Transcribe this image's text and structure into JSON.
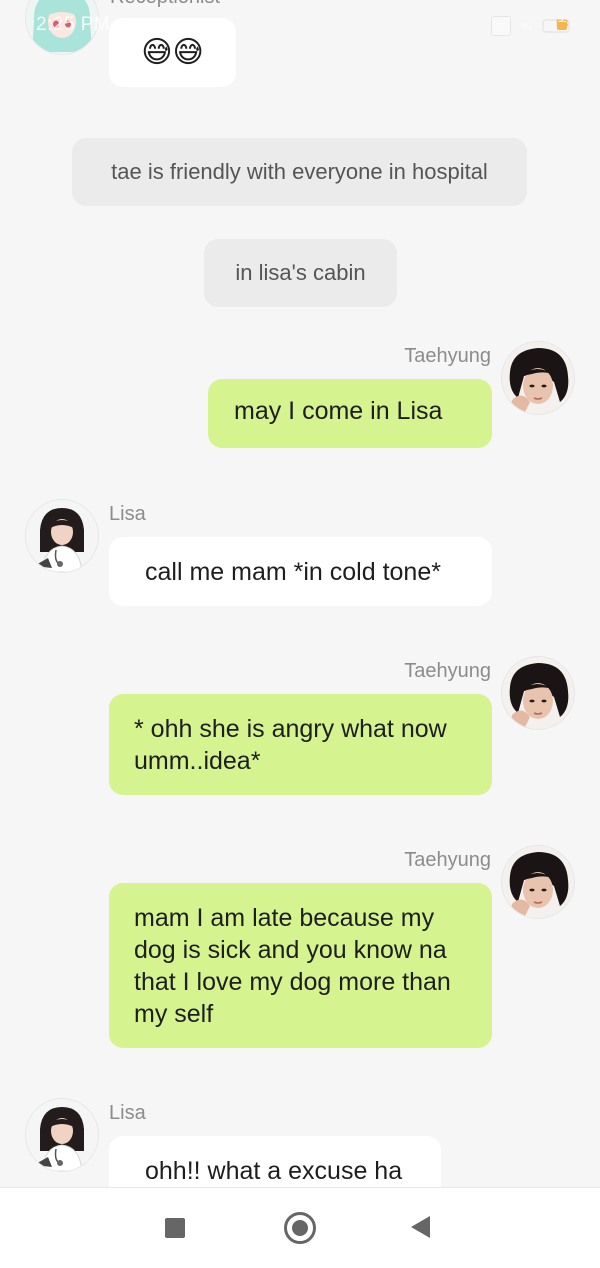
{
  "status_bar": {
    "time": "2:25 PM",
    "network": "4G",
    "battery": "53"
  },
  "messages": [
    {
      "sender": "Receptionist",
      "side": "left",
      "text": "😅😅",
      "style": "white"
    },
    {
      "type": "narration",
      "text": "tae is friendly with everyone in hospital"
    },
    {
      "type": "narration",
      "text": "in lisa's cabin"
    },
    {
      "sender": "Taehyung",
      "side": "right",
      "text": "may I come in Lisa",
      "style": "green"
    },
    {
      "sender": "Lisa",
      "side": "left",
      "text": "call me mam *in cold tone*",
      "style": "white"
    },
    {
      "sender": "Taehyung",
      "side": "right",
      "text": "* ohh she is angry what now umm..idea*",
      "style": "green"
    },
    {
      "sender": "Taehyung",
      "side": "right",
      "text": "mam I am late because my dog is sick and you know na that I love my dog more than my self",
      "style": "green"
    },
    {
      "sender": "Lisa",
      "side": "left",
      "text": "ohh!! what a excuse ha",
      "style": "white"
    }
  ],
  "icons": {
    "recent_apps": "square-icon",
    "home": "circle-home-icon",
    "back": "triangle-back-icon"
  },
  "colors": {
    "background": "#f6f6f6",
    "sent_bubble": "#d5f38f",
    "received_bubble": "#ffffff",
    "narration_bubble": "#ebebeb",
    "name_text": "#8c8c8c"
  }
}
